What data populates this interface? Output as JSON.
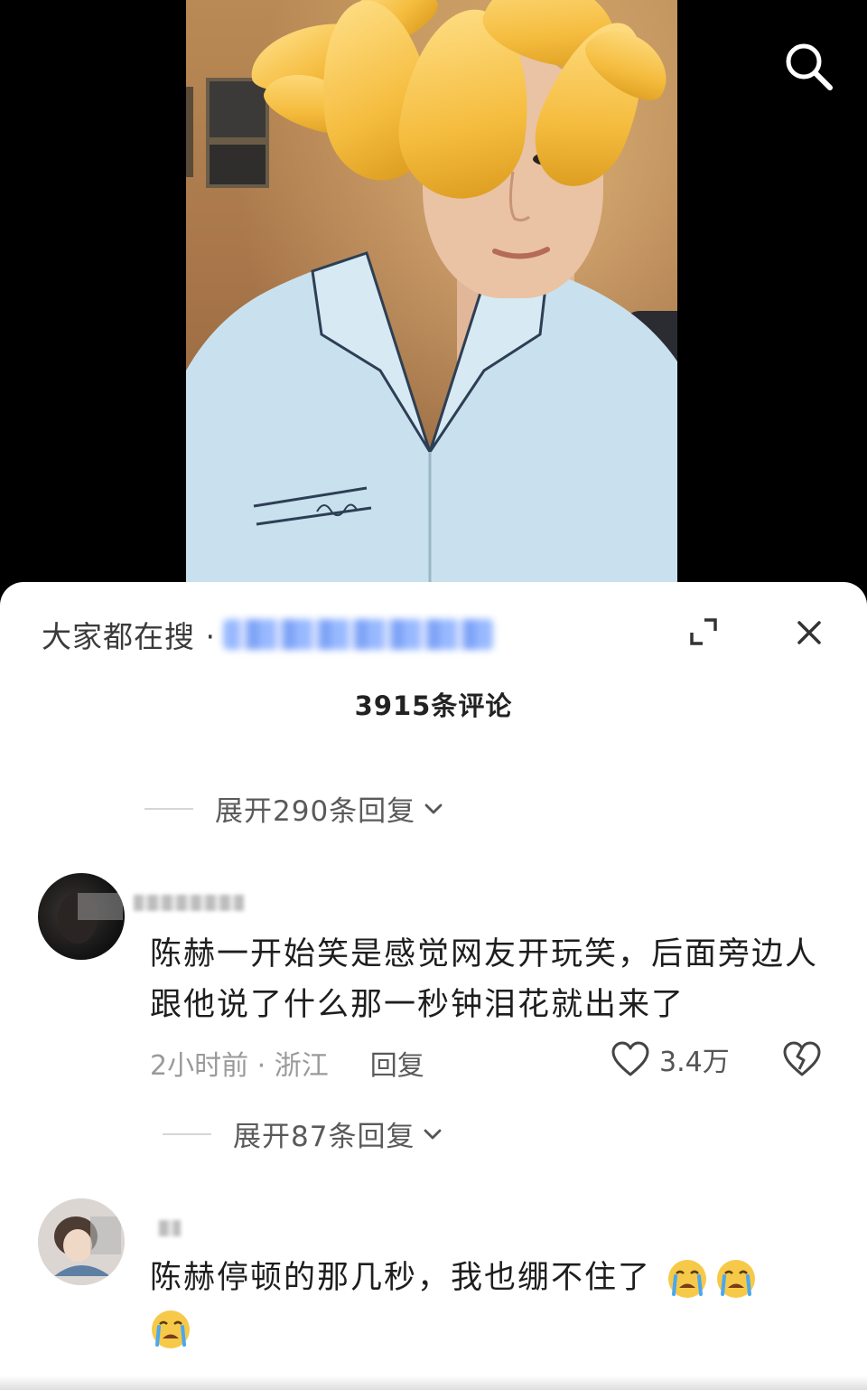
{
  "video": {
    "search_icon": "search-icon"
  },
  "sheet": {
    "search_prefix": "大家都在搜 ·",
    "expand_icon": "expand-icon",
    "close_icon": "close-icon",
    "comment_count": "3915条评论"
  },
  "threads": [
    {
      "expand_replies": "展开290条回复"
    },
    {
      "text": "陈赫一开始笑是感觉网友开玩笑，后面旁边人跟他说了什么那一秒钟泪花就出来了",
      "time": "2小时前 · 浙江",
      "reply_label": "回复",
      "likes": "3.4万",
      "expand_replies": "展开87条回复"
    },
    {
      "text": "陈赫停顿的那几秒，我也绷不住了",
      "emoji": "loudly-crying-face"
    }
  ]
}
